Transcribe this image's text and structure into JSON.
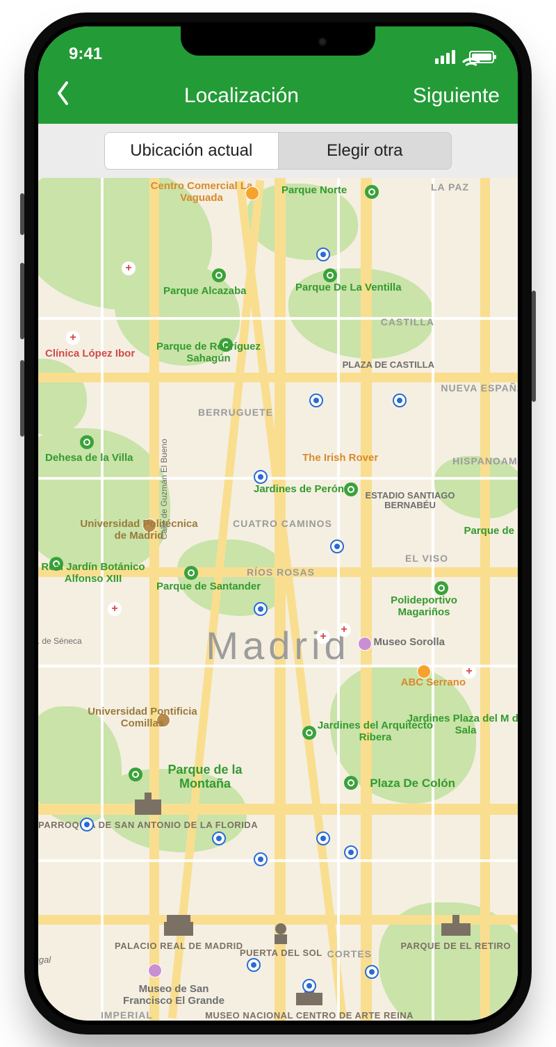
{
  "status": {
    "time": "9:41"
  },
  "nav": {
    "title": "Localización",
    "next": "Siguiente"
  },
  "segmented": {
    "active": "Ubicación actual",
    "other": "Elegir otra"
  },
  "map": {
    "cityLabel": "Madrid",
    "districts": {
      "berruguete": "BERRUGUETE",
      "cuatroCaminos": "CUATRO CAMINOS",
      "riosRosas": "RÍOS ROSAS",
      "elViso": "EL VISO",
      "castilla": "CASTILLA",
      "nuevaEspana": "NUEVA ESPAÑA",
      "hispanoame": "HISPANOAME",
      "laPaz": "LA PAZ",
      "cortes": "CORTES",
      "imperial": "IMPERIAL"
    },
    "pois": {
      "centroVaguada": "Centro Comercial La Vaguada",
      "parqueNorte": "Parque Norte",
      "parqueAlcazaba": "Parque Alcazaba",
      "parqueVentilla": "Parque De La Ventilla",
      "clinicaLopezIbor": "Clínica López Ibor",
      "rodriguezSahagun": "Parque de Rodríguez Sahagún",
      "plazaCastilla": "PLAZA DE CASTILLA",
      "dehesaVilla": "Dehesa de la Villa",
      "irishRover": "The Irish Rover",
      "jardinesPeron": "Jardines de Perón",
      "bernabeu": "ESTADIO SANTIAGO BERNABÉU",
      "parqueB": "Parque de B",
      "univPolitecnica": "Universidad Politécnica de Madrid",
      "jardinBotanico": "Real Jardín Botánico Alfonso XIII",
      "parqueSantander": "Parque de Santander",
      "polideportivoMag": "Polideportivo Magariños",
      "museoSorolla": "Museo Sorolla",
      "abcSerrano": "ABC Serrano",
      "calleGuzman": "Calle de Guzmán El Bueno",
      "cSeneca": "C. de Séneca",
      "univPontificia": "Universidad Pontificia Comillas",
      "jardinesRibera": "Jardines del Arquitecto Ribera",
      "jardinesSalamanca": "Jardines Plaza del M de Sala",
      "parqueMontana": "Parque de la Montaña",
      "plazaColon": "Plaza De Colón",
      "parroquiaSanAntonio": "PARROQUIA DE SAN ANTONIO DE LA FLORIDA",
      "palacioReal": "PALACIO REAL DE MADRID",
      "puertaSol": "PUERTA DEL SOL",
      "parqueRetiro": "PARQUE DE EL RETIRO",
      "museoSanFrancisco": "Museo de San Francisco El Grande",
      "museoReinaSofia": "MUSEO NACIONAL CENTRO DE ARTE REINA",
      "portugal": "tugal"
    }
  }
}
